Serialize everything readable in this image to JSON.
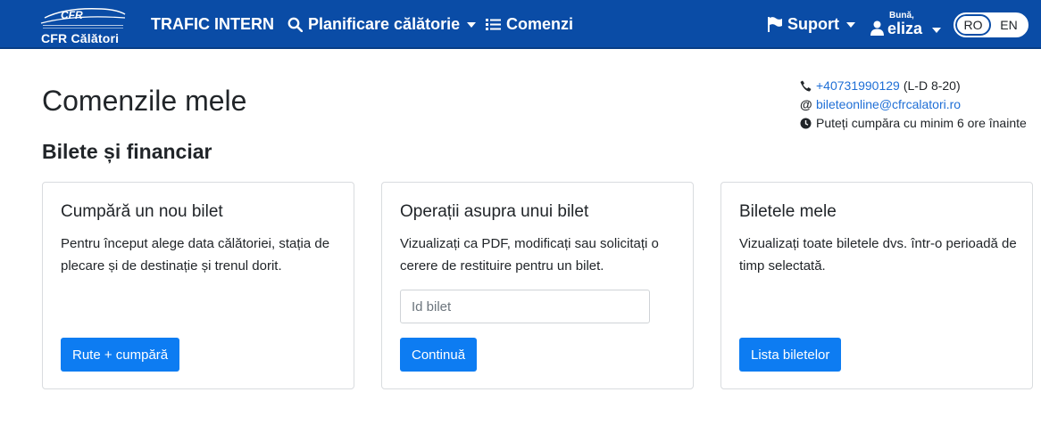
{
  "navbar": {
    "brand_name": "CFR Călători",
    "brand_logo_text": "CFR",
    "items": [
      {
        "label": "TRAFIC INTERN",
        "icon": "none"
      },
      {
        "label": "Planificare călătorie",
        "icon": "search-icon"
      },
      {
        "label": "Comenzi",
        "icon": "list-icon"
      },
      {
        "label": "Suport",
        "icon": "flag-icon"
      }
    ],
    "user": {
      "greeting": "Bună,",
      "name": "eliza"
    },
    "languages": {
      "active": "RO",
      "other": "EN"
    },
    "bg_color": "#0a4ca6"
  },
  "page": {
    "title": "Comenzile mele",
    "section": "Bilete și financiar"
  },
  "contact": {
    "phone": "+40731990129",
    "phone_hours": "(L-D 8-20)",
    "email": "bileteonline@cfrcalatori.ro",
    "notice": "Puteți cumpăra cu minim 6 ore înainte"
  },
  "cards": [
    {
      "title": "Cumpără un nou bilet",
      "text": "Pentru început alege data călătoriei, stația de plecare și de destinație și trenul dorit.",
      "button": "Rute + cumpără"
    },
    {
      "title": "Operații asupra unui bilet",
      "text": "Vizualizați ca PDF, modificați sau solicitați o cerere de restituire pentru un bilet.",
      "input_placeholder": "Id bilet",
      "input_value": "",
      "button": "Continuă"
    },
    {
      "title": "Biletele mele",
      "text": "Vizualizați toate biletele dvs. într-o perioadă de timp selectată.",
      "button": "Lista biletelor"
    }
  ],
  "colors": {
    "primary_button": "#0d7cf2",
    "link": "#1f6fd6"
  }
}
